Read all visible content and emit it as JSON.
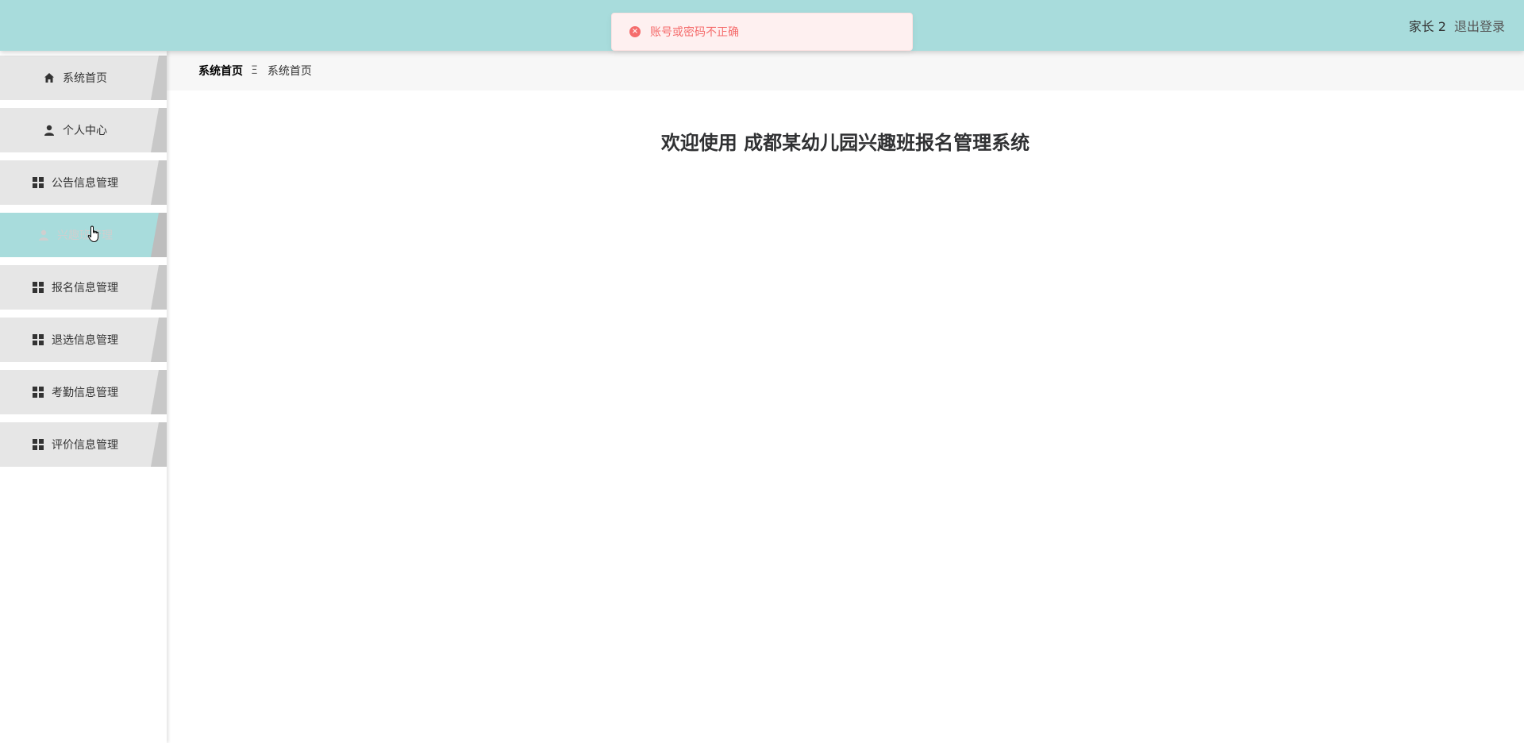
{
  "header": {
    "username": "家长 2",
    "logout_label": "退出登录"
  },
  "toast": {
    "message": "账号或密码不正确",
    "icon": "error-circle-icon",
    "color": "#f56c6c"
  },
  "sidebar": {
    "items": [
      {
        "label": "系统首页",
        "icon": "home-icon"
      },
      {
        "label": "个人中心",
        "icon": "user-icon"
      },
      {
        "label": "公告信息管理",
        "icon": "grid-icon"
      },
      {
        "label": "兴趣班管理",
        "icon": "user-icon",
        "active": true
      },
      {
        "label": "报名信息管理",
        "icon": "grid-icon"
      },
      {
        "label": "退选信息管理",
        "icon": "grid-icon"
      },
      {
        "label": "考勤信息管理",
        "icon": "grid-icon"
      },
      {
        "label": "评价信息管理",
        "icon": "grid-icon"
      }
    ]
  },
  "breadcrumb": {
    "home": "系统首页",
    "separator": "Ξ",
    "current": "系统首页"
  },
  "main": {
    "welcome": "欢迎使用 成都某幼儿园兴趣班报名管理系统"
  },
  "theme": {
    "header_bg": "#a8dcdc",
    "menu_bg": "#e6e6e6"
  }
}
